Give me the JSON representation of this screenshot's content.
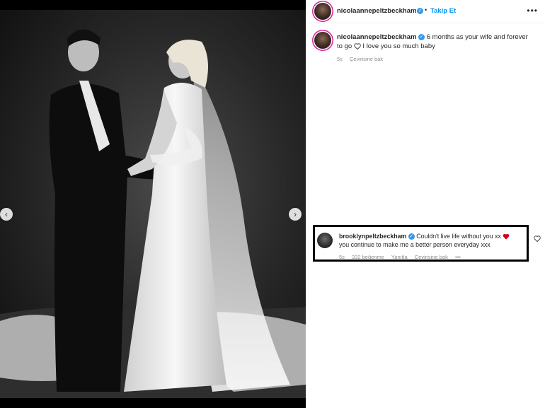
{
  "post": {
    "author": "nicolaannepeltzbeckham",
    "follow_label": "Takip Et",
    "separator": "•",
    "more_icon": "more-horizontal-icon"
  },
  "caption": {
    "username": "nicolaannepeltzbeckham",
    "text_line1": "6 months as your wife and forever",
    "text_line2": "to go",
    "text_line2b": "I love you so much baby",
    "time": "5s",
    "translate_label": "Çevirisine bak"
  },
  "comment": {
    "username": "brooklynpeltzbeckham",
    "text_line1": "Couldn't live life without you xx",
    "text_line2": "you continue to make me a better person everyday xxx",
    "time": "5s",
    "likes": "332 beğenme",
    "reply_label": "Yanıtla",
    "translate_label": "Çevirisine bak",
    "more": "•••",
    "heart_color": "#d0021b"
  },
  "icons": {
    "prev": "‹",
    "next": "›",
    "check": "✓"
  },
  "colors": {
    "accent": "#0095f6",
    "verified": "#3897f0",
    "highlight_border": "#000000"
  }
}
